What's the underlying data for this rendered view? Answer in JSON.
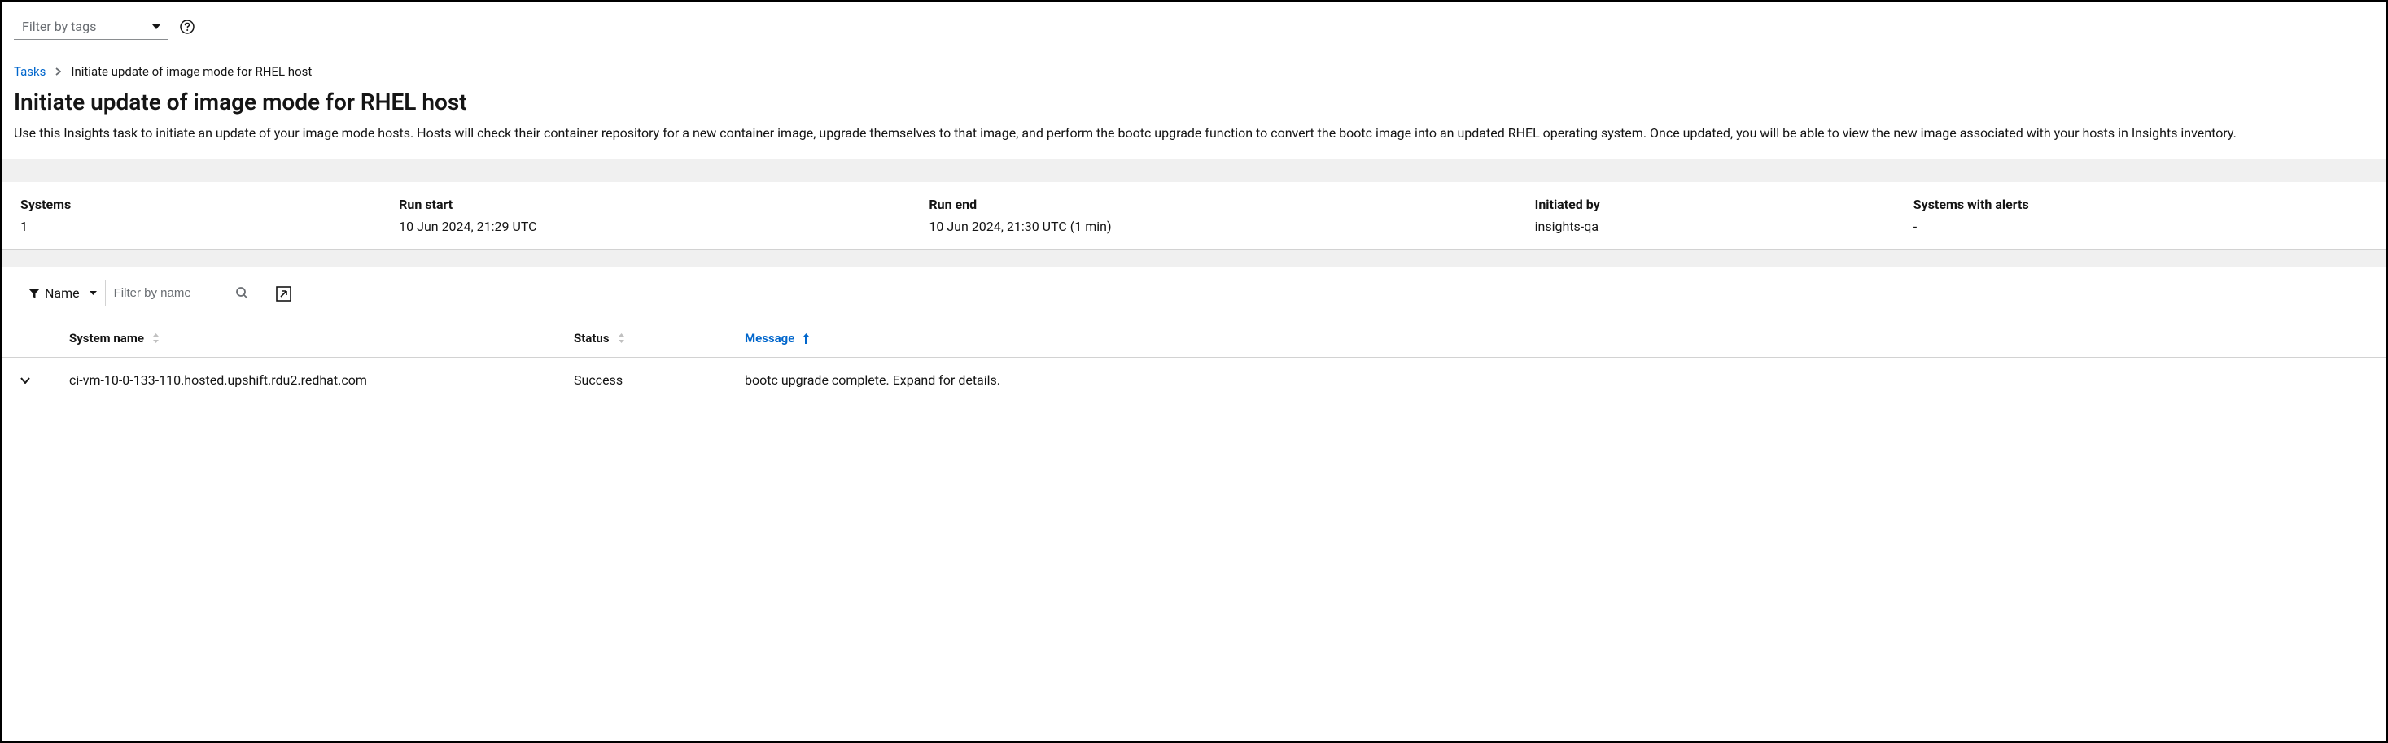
{
  "filter_tags": {
    "placeholder": "Filter by tags"
  },
  "breadcrumb": {
    "root": "Tasks",
    "current": "Initiate update of image mode for RHEL host"
  },
  "page": {
    "title": "Initiate update of image mode for RHEL host",
    "description": "Use this Insights task to initiate an update of your image mode hosts. Hosts will check their container repository for a new container image, upgrade themselves to that image, and perform the bootc upgrade function to convert the bootc image into an updated RHEL operating system. Once updated, you will be able to view the new image associated with your hosts in Insights inventory."
  },
  "summary": {
    "systems_label": "Systems",
    "systems_value": "1",
    "run_start_label": "Run start",
    "run_start_value": "10 Jun 2024, 21:29 UTC",
    "run_end_label": "Run end",
    "run_end_value": "10 Jun 2024, 21:30 UTC (1 min)",
    "initiated_by_label": "Initiated by",
    "initiated_by_value": "insights-qa",
    "alerts_label": "Systems with alerts",
    "alerts_value": "-"
  },
  "toolbar": {
    "filter_type": "Name",
    "filter_placeholder": "Filter by name"
  },
  "table": {
    "headers": {
      "system_name": "System name",
      "status": "Status",
      "message": "Message"
    },
    "rows": [
      {
        "system_name": "ci-vm-10-0-133-110.hosted.upshift.rdu2.redhat.com",
        "status": "Success",
        "message": "bootc upgrade complete. Expand for details."
      }
    ]
  }
}
